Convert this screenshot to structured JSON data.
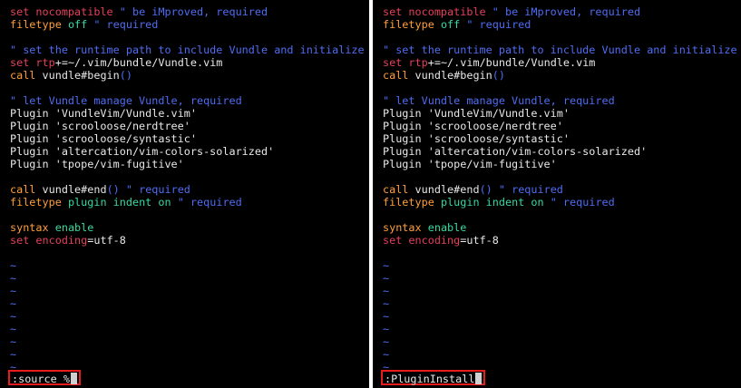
{
  "colors": {
    "background": "#000000",
    "keyword_red": "#e4405b",
    "keyword_orange": "#ff9f3a",
    "keyword_green": "#38d9a0",
    "comment_blue": "#4f6df3",
    "text": "#e8e8e8",
    "highlight_box": "#e81c1c"
  },
  "editor": {
    "l1_cmd": "set",
    "l1_opt": "nocompatible",
    "l1_comment": " \" be iMproved, required",
    "l2_cmd": "filetype",
    "l2_val": "off",
    "l2_comment": " \" required",
    "l4_comment": "\" set the runtime path to include Vundle and initialize",
    "l5_cmd": "set",
    "l5_opt": "rtp",
    "l5_op": "+=",
    "l5_val": "~/.vim/bundle/Vundle.vim",
    "l6_cmd": "call",
    "l6_fn": "vundle#begin",
    "l6_paren": "()",
    "l8_comment": "\" let Vundle manage Vundle, required",
    "plugins": [
      "Plugin 'VundleVim/Vundle.vim'",
      "Plugin 'scrooloose/nerdtree'",
      "Plugin 'scrooloose/syntastic'",
      "Plugin 'altercation/vim-colors-solarized'",
      "Plugin 'tpope/vim-fugitive'"
    ],
    "l15_cmd": "call",
    "l15_fn": "vundle#end",
    "l15_paren": "()",
    "l15_comment": " \" required",
    "l16_cmd": "filetype",
    "l16_a": "plugin",
    "l16_b": "indent",
    "l16_c": "on",
    "l16_comment": " \" required",
    "l18_cmd": "syntax",
    "l18_val": "enable",
    "l19_cmd": "set",
    "l19_opt": "encoding",
    "l19_op": "=",
    "l19_val": "utf-8",
    "tilde": "~"
  },
  "left_pane": {
    "command": ":source %"
  },
  "right_pane": {
    "command": ":PluginInstall"
  }
}
